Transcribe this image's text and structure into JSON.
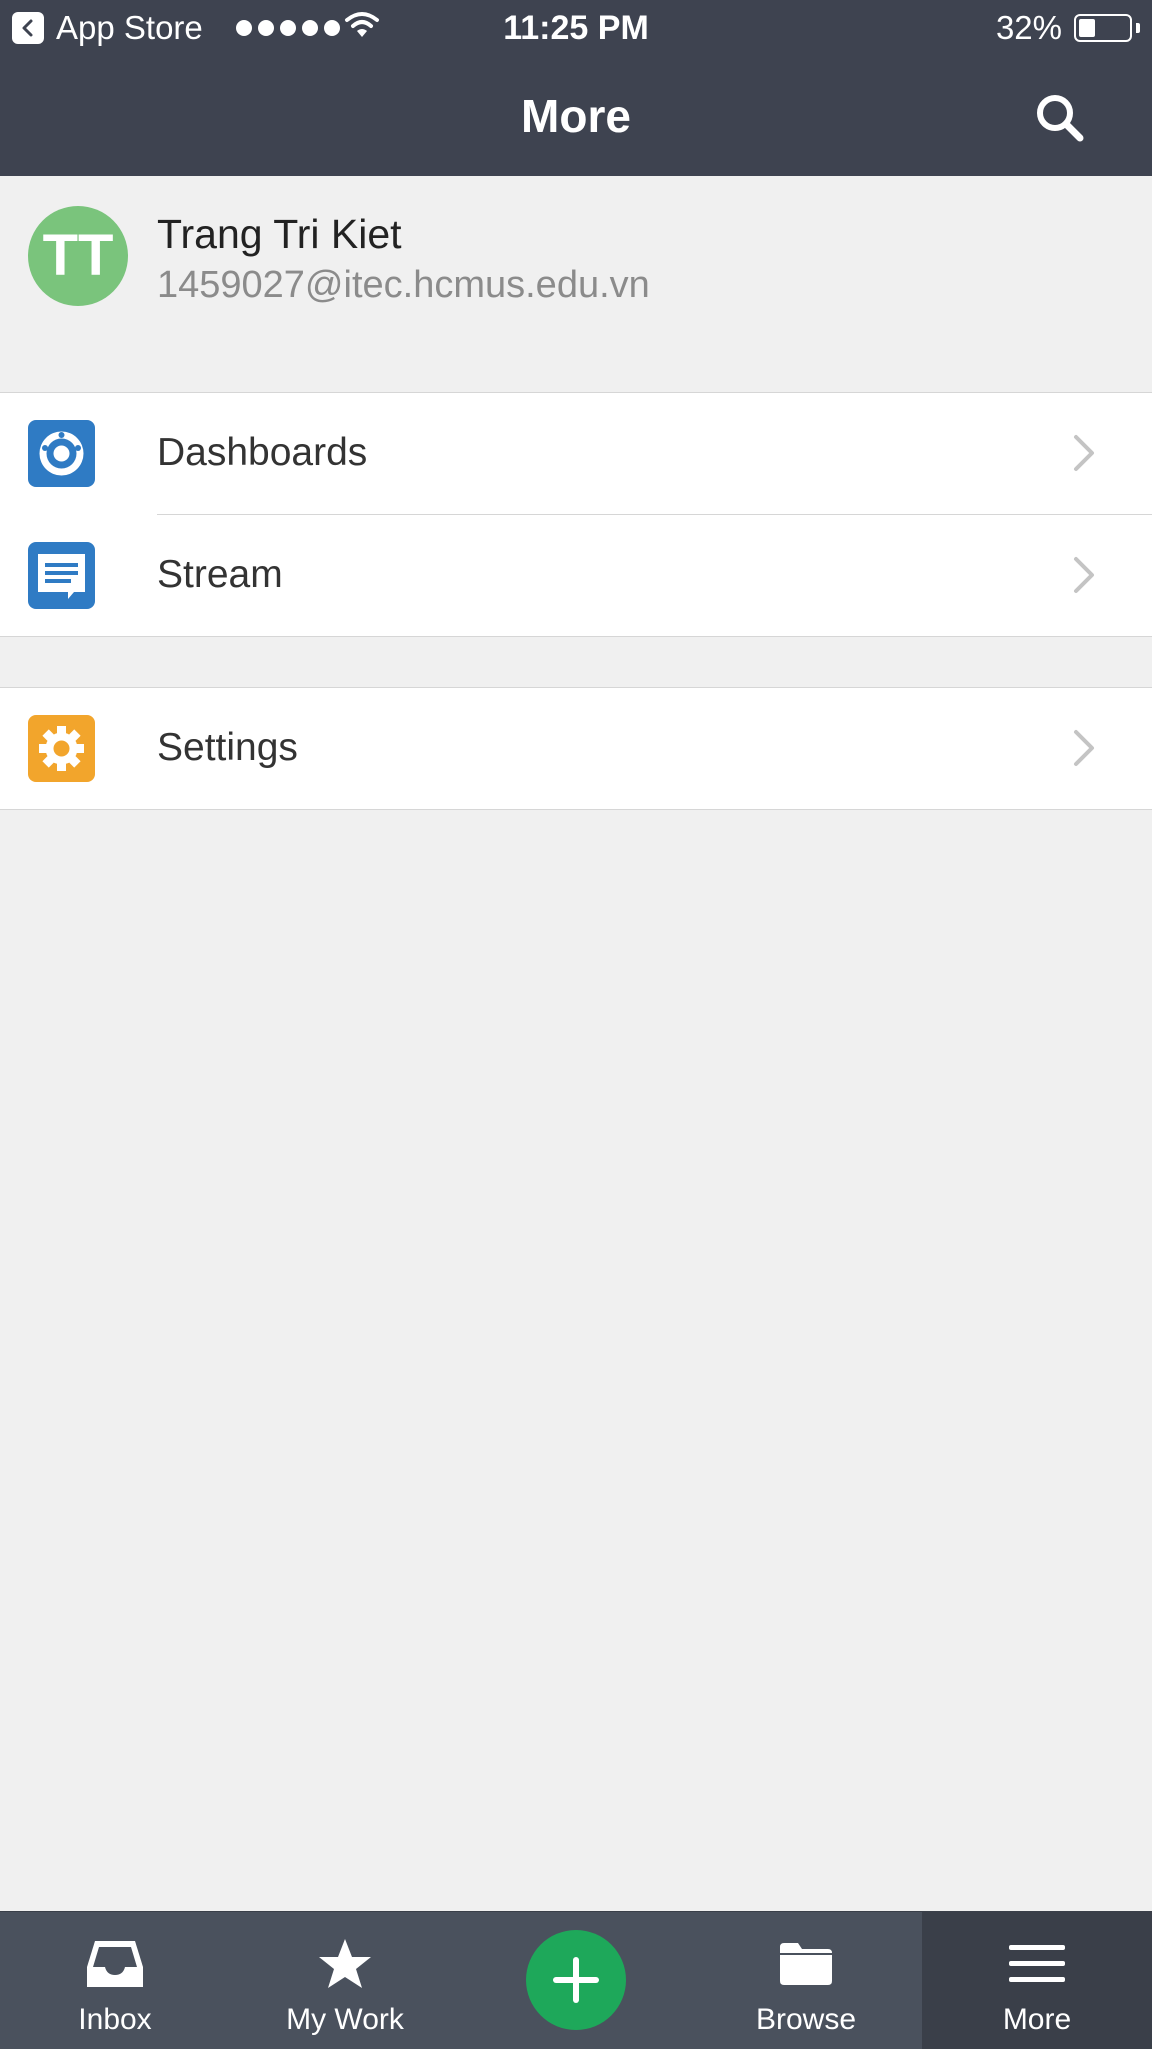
{
  "status_bar": {
    "back_app": "App Store",
    "time": "11:25 PM",
    "battery": "32%"
  },
  "nav": {
    "title": "More"
  },
  "profile": {
    "initials": "TT",
    "name": "Trang Tri Kiet",
    "email": "1459027@itec.hcmus.edu.vn"
  },
  "menu": {
    "group1": [
      {
        "label": "Dashboards",
        "icon": "dashboard-icon",
        "color": "#2f7bc4"
      },
      {
        "label": "Stream",
        "icon": "stream-icon",
        "color": "#2f7bc4"
      }
    ],
    "group2": [
      {
        "label": "Settings",
        "icon": "gear-icon",
        "color": "#f2a52c"
      }
    ]
  },
  "tabbar": {
    "inbox": "Inbox",
    "mywork": "My Work",
    "browse": "Browse",
    "more": "More",
    "add_color": "#1ea85a"
  }
}
